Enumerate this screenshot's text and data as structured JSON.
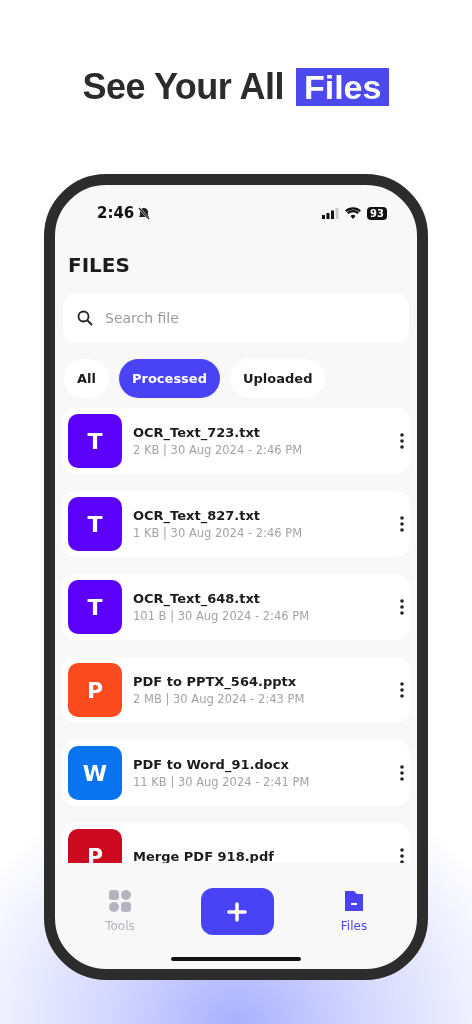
{
  "headline": {
    "text": "See Your All",
    "highlight": "Files"
  },
  "status_bar": {
    "time": "2:46",
    "battery": "93"
  },
  "title": "FILES",
  "search": {
    "placeholder": "Search file"
  },
  "filters": [
    {
      "label": "All",
      "selected": false
    },
    {
      "label": "Processed",
      "selected": true
    },
    {
      "label": "Uploaded",
      "selected": false
    }
  ],
  "files": [
    {
      "letter": "T",
      "color": "#5b00fa",
      "name": "OCR_Text_723.txt",
      "meta": "2 KB | 30 Aug 2024 - 2:46 PM"
    },
    {
      "letter": "T",
      "color": "#5b00fa",
      "name": "OCR_Text_827.txt",
      "meta": "1 KB | 30 Aug 2024 - 2:46 PM"
    },
    {
      "letter": "T",
      "color": "#5b00fa",
      "name": "OCR_Text_648.txt",
      "meta": "101 B | 30 Aug 2024 - 2:46 PM"
    },
    {
      "letter": "P",
      "color": "#fb4b1f",
      "name": "PDF to PPTX_564.pptx",
      "meta": "2 MB | 30 Aug 2024 - 2:43 PM"
    },
    {
      "letter": "W",
      "color": "#0a73ef",
      "name": "PDF to Word_91.docx",
      "meta": "11 KB | 30 Aug 2024 - 2:41 PM"
    },
    {
      "letter": "P",
      "color": "#cc0a1f",
      "name": "Merge PDF 918.pdf"
    }
  ],
  "nav": [
    {
      "kind": "tools",
      "label": "Tools",
      "selected": false
    },
    {
      "kind": "add"
    },
    {
      "kind": "files",
      "label": "Files",
      "selected": true
    }
  ]
}
